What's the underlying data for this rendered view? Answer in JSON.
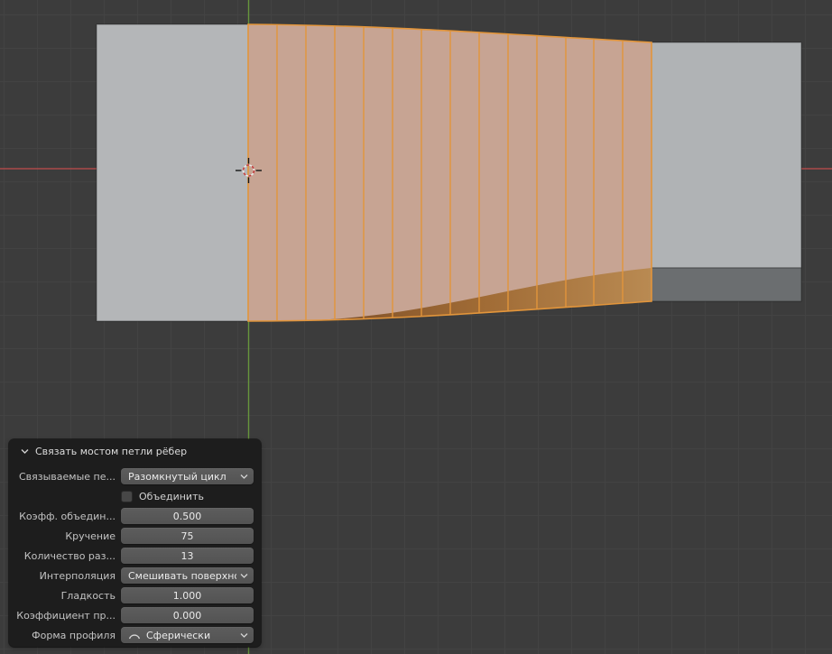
{
  "viewport": {
    "background_color": "#3c3c3c",
    "grid_color": "#434343",
    "axis_x_color": "#b05252",
    "axis_z_color": "#6aa03c"
  },
  "mesh": {
    "unselected_face_color": "#b4b6b8",
    "right_block_face_color": "#b0b3b5",
    "right_block_bottom_color": "#6b6e70",
    "selected_face_color": "#c7a493",
    "selected_edge_color": "#e2953b",
    "underside_dark_color": "#7c4e28",
    "underside_light_color": "#b98a52"
  },
  "panel": {
    "title": "Связать мостом петли рёбер",
    "rows": [
      {
        "label": "Связываемые пе...",
        "value": "Разомкнутый цикл",
        "type": "dropdown"
      },
      {
        "label": "",
        "value": "Объединить",
        "type": "checkbox",
        "checked": false
      },
      {
        "label": "Коэфф. объедин...",
        "value": "0.500",
        "type": "number"
      },
      {
        "label": "Кручение",
        "value": "75",
        "type": "number"
      },
      {
        "label": "Количество раз...",
        "value": "13",
        "type": "number"
      },
      {
        "label": "Интерполяция",
        "value": "Смешивать поверхнос...",
        "type": "dropdown"
      },
      {
        "label": "Гладкость",
        "value": "1.000",
        "type": "number"
      },
      {
        "label": "Коэффициент пр...",
        "value": "0.000",
        "type": "number"
      },
      {
        "label": "Форма профиля",
        "value": "Сферически",
        "type": "dropdown-icon"
      }
    ]
  }
}
